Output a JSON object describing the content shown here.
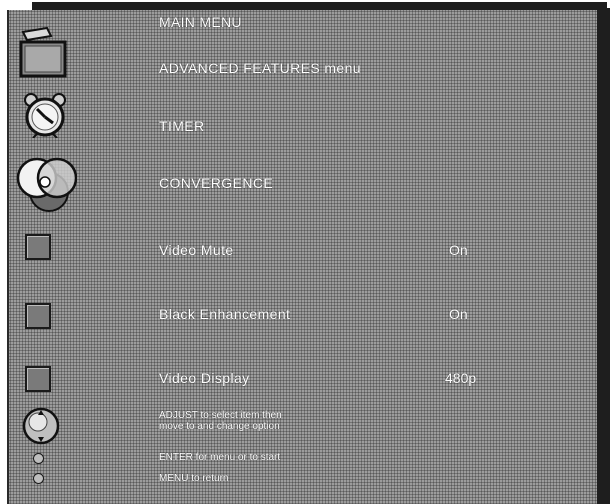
{
  "menu": {
    "title": "MAIN MENU",
    "items": [
      {
        "label": "ADVANCED FEATURES menu",
        "icon": "folder-menu-icon"
      },
      {
        "label": "TIMER",
        "icon": "alarm-clock-icon"
      },
      {
        "label": "CONVERGENCE",
        "icon": "convergence-circles-icon"
      },
      {
        "label": "Video Mute",
        "value": "On",
        "icon": "checkbox-icon"
      },
      {
        "label": "Black Enhancement",
        "value": "On",
        "icon": "checkbox-icon"
      },
      {
        "label": "Video Display",
        "value": "480p",
        "icon": "checkbox-icon"
      }
    ]
  },
  "help": {
    "adjust_line1": "ADJUST to select item then",
    "adjust_line2": "move to and change option",
    "enter": "ENTER for menu or to start",
    "menu": "MENU to return",
    "icons": [
      "joystick-icon",
      "enter-button-icon",
      "menu-button-icon"
    ]
  }
}
